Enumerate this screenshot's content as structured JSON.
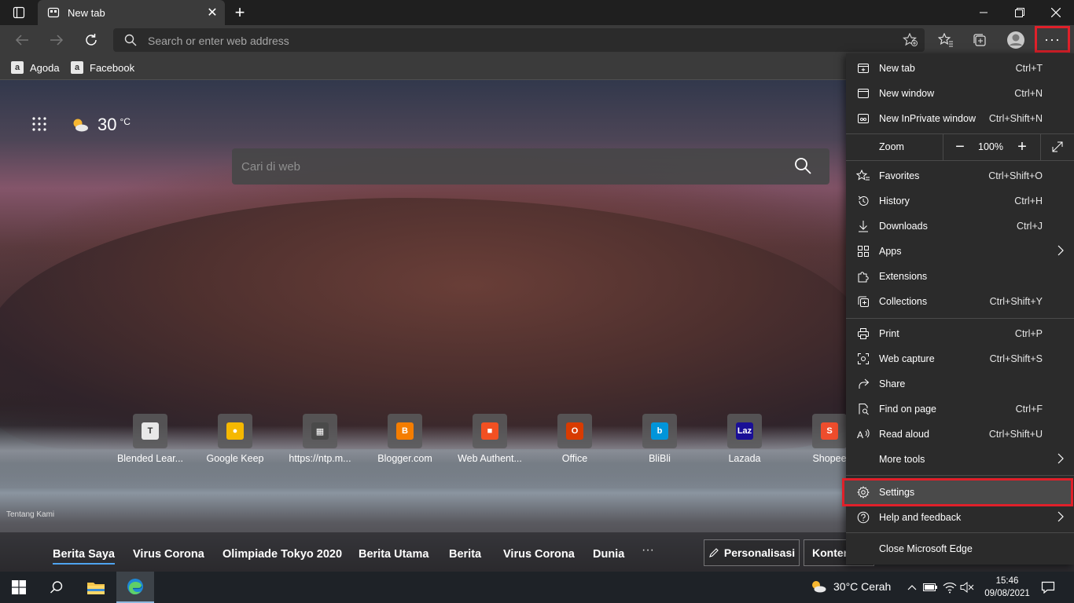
{
  "browser": {
    "tab_title": "New tab",
    "address_placeholder": "Search or enter web address",
    "favorites": [
      {
        "label": "Agoda",
        "icon": "a"
      },
      {
        "label": "Facebook",
        "icon": "a"
      }
    ]
  },
  "ntp": {
    "temperature": "30",
    "temperature_unit": "°C",
    "search_placeholder": "Cari di web",
    "quick_links": [
      {
        "label": "Blended Lear...",
        "color": "#e8e8e8",
        "glyph": "T"
      },
      {
        "label": "Google Keep",
        "color": "#f5b800",
        "glyph": "●"
      },
      {
        "label": "https://ntp.m...",
        "color": "#4a4a4a",
        "glyph": "▦"
      },
      {
        "label": "Blogger.com",
        "color": "#f57d00",
        "glyph": "B"
      },
      {
        "label": "Web Authent...",
        "color": "#f25022",
        "glyph": "■"
      },
      {
        "label": "Office",
        "color": "#d83b01",
        "glyph": "O"
      },
      {
        "label": "BliBli",
        "color": "#0095da",
        "glyph": "b"
      },
      {
        "label": "Lazada",
        "color": "#1a0f96",
        "glyph": "Laz"
      },
      {
        "label": "Shopee",
        "color": "#ee4d2d",
        "glyph": "S"
      }
    ],
    "about_text": "Tentang Kami",
    "news_tabs": [
      "Berita Saya",
      "Virus Corona",
      "Olimpiade Tokyo 2020",
      "Berita Utama",
      "Berita",
      "Virus Corona",
      "Dunia"
    ],
    "news_more": "···",
    "personalize_label": "Personalisasi",
    "content_label": "Konten"
  },
  "menu": {
    "items": [
      {
        "label": "New tab",
        "shortcut": "Ctrl+T"
      },
      {
        "label": "New window",
        "shortcut": "Ctrl+N"
      },
      {
        "label": "New InPrivate window",
        "shortcut": "Ctrl+Shift+N"
      }
    ],
    "zoom_label": "Zoom",
    "zoom_value": "100%",
    "items2": [
      {
        "label": "Favorites",
        "shortcut": "Ctrl+Shift+O"
      },
      {
        "label": "History",
        "shortcut": "Ctrl+H"
      },
      {
        "label": "Downloads",
        "shortcut": "Ctrl+J"
      },
      {
        "label": "Apps",
        "shortcut": ""
      },
      {
        "label": "Extensions",
        "shortcut": ""
      },
      {
        "label": "Collections",
        "shortcut": "Ctrl+Shift+Y"
      }
    ],
    "items3": [
      {
        "label": "Print",
        "shortcut": "Ctrl+P"
      },
      {
        "label": "Web capture",
        "shortcut": "Ctrl+Shift+S"
      },
      {
        "label": "Share",
        "shortcut": ""
      },
      {
        "label": "Find on page",
        "shortcut": "Ctrl+F"
      },
      {
        "label": "Read aloud",
        "shortcut": "Ctrl+Shift+U"
      },
      {
        "label": "More tools",
        "shortcut": ""
      }
    ],
    "settings": "Settings",
    "help": "Help and feedback",
    "close": "Close Microsoft Edge"
  },
  "taskbar": {
    "weather": "30°C  Cerah",
    "time": "15:46",
    "date": "09/08/2021"
  },
  "colors": {
    "highlight": "#e0202a",
    "menu_bg": "#2b2b2b",
    "toolbar_bg": "#3b3b3b"
  }
}
